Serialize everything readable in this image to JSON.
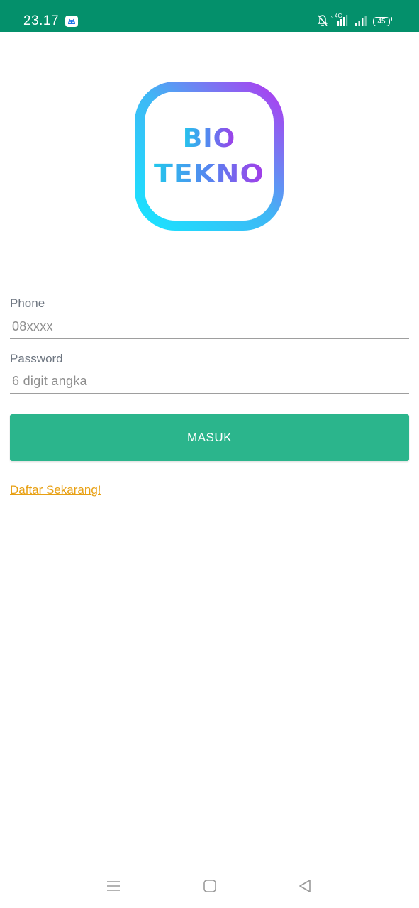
{
  "status_bar": {
    "time": "23.17",
    "network": "4G",
    "battery": "45",
    "icons": [
      "android-app-icon",
      "bell-muted-icon",
      "signal-4g-icon",
      "signal-icon",
      "battery-icon"
    ]
  },
  "logo": {
    "line1": "BIO",
    "line2": "TEKNO"
  },
  "form": {
    "phone_label": "Phone",
    "phone_placeholder": "08xxxx",
    "password_label": "Password",
    "password_placeholder": "6 digit angka",
    "login_button": "MASUK",
    "register_link": "Daftar Sekarang!"
  },
  "colors": {
    "status_bar": "#04906b",
    "primary_button": "#2bb58c",
    "link": "#e8a013",
    "logo_gradient_start": "#19e4ff",
    "logo_gradient_end": "#b03af0"
  },
  "nav_bar": {
    "icons": [
      "menu-icon",
      "home-square-icon",
      "back-triangle-icon"
    ]
  }
}
